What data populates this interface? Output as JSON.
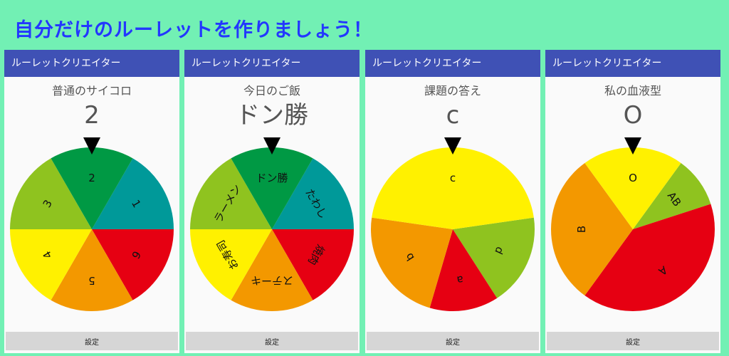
{
  "banner": "自分だけのルーレットを作りましょう！",
  "phones": [
    {
      "app_title": "ルーレットクリエイター",
      "title": "普通のサイコロ",
      "result": "2",
      "settings_label": "設定",
      "segments": [
        {
          "label": "1",
          "color": "#009999",
          "weight": 1
        },
        {
          "label": "6",
          "color": "#e60012",
          "weight": 1
        },
        {
          "label": "5",
          "color": "#f39800",
          "weight": 1
        },
        {
          "label": "4",
          "color": "#fff100",
          "weight": 1
        },
        {
          "label": "3",
          "color": "#8fc31f",
          "weight": 1
        },
        {
          "label": "2",
          "color": "#009944",
          "weight": 1
        }
      ]
    },
    {
      "app_title": "ルーレットクリエイター",
      "title": "今日のご飯",
      "result": "ドン勝",
      "settings_label": "設定",
      "segments": [
        {
          "label": "たわし",
          "color": "#009999",
          "weight": 1
        },
        {
          "label": "焼肉",
          "color": "#e60012",
          "weight": 1
        },
        {
          "label": "ステーキ",
          "color": "#f39800",
          "weight": 1
        },
        {
          "label": "お寿司",
          "color": "#fff100",
          "weight": 1
        },
        {
          "label": "ラーメン",
          "color": "#8fc31f",
          "weight": 1
        },
        {
          "label": "ドン勝",
          "color": "#009944",
          "weight": 1
        }
      ]
    },
    {
      "app_title": "ルーレットクリエイター",
      "title": "課題の答え",
      "result": "c",
      "settings_label": "設定",
      "segments": [
        {
          "label": "d",
          "color": "#8fc31f",
          "weight": 2
        },
        {
          "label": "a",
          "color": "#e60012",
          "weight": 1.5
        },
        {
          "label": "b",
          "color": "#f39800",
          "weight": 2.5
        },
        {
          "label": "c",
          "color": "#fff100",
          "weight": 5
        }
      ]
    },
    {
      "app_title": "ルーレットクリエイター",
      "title": "私の血液型",
      "result": "O",
      "settings_label": "設定",
      "segments": [
        {
          "label": "AB",
          "color": "#8fc31f",
          "weight": 1
        },
        {
          "label": "A",
          "color": "#e60012",
          "weight": 4
        },
        {
          "label": "B",
          "color": "#f39800",
          "weight": 3
        },
        {
          "label": "O",
          "color": "#fff100",
          "weight": 2
        }
      ]
    }
  ]
}
